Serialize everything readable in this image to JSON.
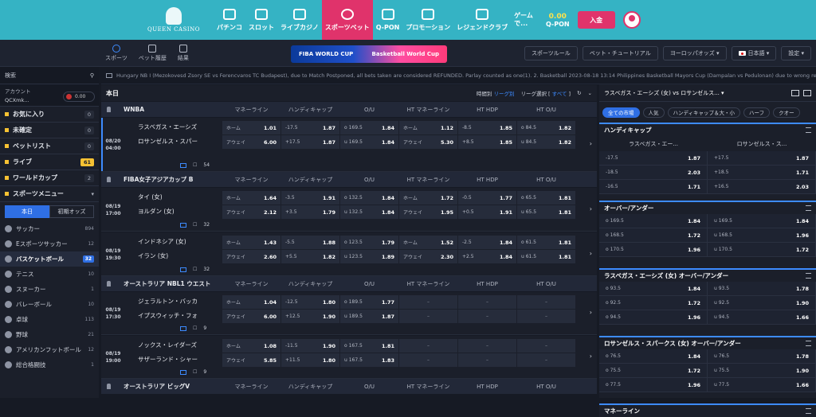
{
  "brand": {
    "logo_text": "QUEEN CASINO"
  },
  "nav": [
    {
      "label": "パチンコ",
      "icon": "pachinko-icon"
    },
    {
      "label": "スロット",
      "icon": "slot-icon"
    },
    {
      "label": "ライブカジノ",
      "icon": "live-casino-icon"
    },
    {
      "label": "スポーツベット",
      "icon": "sports-ball-icon",
      "active": true
    },
    {
      "label": "Q-PON",
      "icon": "qpon-icon"
    },
    {
      "label": "プロモーション",
      "icon": "gift-icon"
    },
    {
      "label": "レジェンドクラブ",
      "icon": "crown-icon"
    },
    {
      "label": "ゲーム\nで...",
      "icon": ""
    }
  ],
  "balance": {
    "amount": "0.00",
    "label": "Q-PON"
  },
  "deposit_label": "入金",
  "subnav": [
    {
      "label": "スポーツ"
    },
    {
      "label": "ベット履歴"
    },
    {
      "label": "結果"
    }
  ],
  "banner": {
    "left": "FIBA WORLD CUP",
    "right": "Basketball World Cup"
  },
  "subbtns": {
    "rules": "スポーツルール",
    "tutorial": "ベット・チュートリアル",
    "odds": "ヨーロッパオッズ ▾",
    "lang": "日本語 ▾",
    "settings": "設定 ▾"
  },
  "ticker": "Hungary NB I (Mezokovesd Zsory SE vs Ferencvaros TC Budapest), due to Match Postponed, all bets taken are considered REFUNDED. Parlay counted as one(1).  2. Basketball 2023-08-18 13:14 Philippines Basketball Mayors Cup (Dampalan vs Pedulonan) due to wrong result received 4th",
  "sidebar": {
    "search": "検索",
    "account_label": "アカウント",
    "account_id": "QCXmk...",
    "account_bal": "0.00",
    "items": [
      {
        "label": "お気に入り",
        "count": "0"
      },
      {
        "label": "未確定",
        "count": "0"
      },
      {
        "label": "ベットリスト",
        "count": "0"
      },
      {
        "label": "ライブ",
        "count": "61",
        "hl": true
      },
      {
        "label": "ワールドカップ",
        "count": "2"
      }
    ],
    "menu_label": "スポーツメニュー",
    "seg": [
      "本日",
      "初期オッズ"
    ],
    "sports": [
      {
        "label": "サッカー",
        "count": "894"
      },
      {
        "label": "Eスポーツサッカー",
        "count": "12"
      },
      {
        "label": "バスケットボール",
        "count": "32",
        "on": true
      },
      {
        "label": "テニス",
        "count": "10"
      },
      {
        "label": "スヌーカー",
        "count": "1"
      },
      {
        "label": "バレーボール",
        "count": "10"
      },
      {
        "label": "卓球",
        "count": "113"
      },
      {
        "label": "野球",
        "count": "21"
      },
      {
        "label": "アメリカンフットボール",
        "count": "12"
      },
      {
        "label": "総合格闘技",
        "count": "1"
      }
    ]
  },
  "main": {
    "title": "本日",
    "sort_label": "時間別",
    "sort_value": "リーグ別",
    "league_sel": "リーグ選択 [",
    "league_sel_val": "すべて",
    "league_sel_end": "]",
    "cols": [
      "マネーライン",
      "ハンディキャップ",
      "O/U",
      "HT マネーライン",
      "HT HDP",
      "HT O/U"
    ],
    "home": "ホーム",
    "away": "アウェイ",
    "leagues": [
      {
        "name": "WNBA"
      },
      {
        "name": "FIBA女子アジアカップ B"
      },
      {
        "name": "オーストラリア NBL1 ウエスト"
      },
      {
        "name": "オーストラリア ビッグV"
      }
    ],
    "matches": [
      {
        "date": "08/20",
        "time": "04:00",
        "t1": "ラスベガス・エーシズ",
        "t2": "ロサンゼルス・スパー",
        "more": "54",
        "o": [
          [
            "1.01",
            "-17.5",
            "1.87",
            "o 169.5",
            "1.84",
            "1.12",
            "-8.5",
            "1.85",
            "o 84.5",
            "1.82"
          ],
          [
            "6.00",
            "+17.5",
            "1.87",
            "u 169.5",
            "1.84",
            "5.30",
            "+8.5",
            "1.85",
            "u 84.5",
            "1.82"
          ]
        ]
      },
      {
        "date": "08/19",
        "time": "17:00",
        "t1": "タイ (女)",
        "t2": "ヨルダン (女)",
        "more": "32",
        "o": [
          [
            "1.64",
            "-3.5",
            "1.91",
            "o 132.5",
            "1.84",
            "1.72",
            "-0.5",
            "1.77",
            "o 65.5",
            "1.81"
          ],
          [
            "2.12",
            "+3.5",
            "1.79",
            "u 132.5",
            "1.84",
            "1.95",
            "+0.5",
            "1.91",
            "u 65.5",
            "1.81"
          ]
        ]
      },
      {
        "date": "08/19",
        "time": "19:30",
        "t1": "インドネシア (女)",
        "t2": "イラン (女)",
        "more": "32",
        "o": [
          [
            "1.43",
            "-5.5",
            "1.88",
            "o 123.5",
            "1.79",
            "1.52",
            "-2.5",
            "1.84",
            "o 61.5",
            "1.81"
          ],
          [
            "2.60",
            "+5.5",
            "1.82",
            "u 123.5",
            "1.89",
            "2.30",
            "+2.5",
            "1.84",
            "u 61.5",
            "1.81"
          ]
        ]
      },
      {
        "date": "08/19",
        "time": "17:30",
        "t1": "ジェラルトン・バッカ",
        "t2": "イプスウィッチ・フォ",
        "more": "9",
        "o": [
          [
            "1.04",
            "-12.5",
            "1.80",
            "o 189.5",
            "1.77",
            "",
            "",
            "",
            "",
            ""
          ],
          [
            "6.00",
            "+12.5",
            "1.90",
            "u 189.5",
            "1.87",
            "",
            "",
            "",
            "",
            ""
          ]
        ]
      },
      {
        "date": "08/19",
        "time": "19:00",
        "t1": "ノックス・レイダーズ",
        "t2": "サザーランド・シャー",
        "more": "9",
        "o": [
          [
            "1.08",
            "-11.5",
            "1.90",
            "o 167.5",
            "1.81",
            "",
            "",
            "",
            "",
            ""
          ],
          [
            "5.85",
            "+11.5",
            "1.80",
            "u 167.5",
            "1.83",
            "",
            "",
            "",
            "",
            ""
          ]
        ]
      }
    ],
    "dash": "–"
  },
  "right": {
    "title": "ラスベガス・エーシズ (女) vs ロサンゼルス... ▾",
    "tabs": [
      "全ての市場",
      "人気",
      "ハンディキャップ＆大・小",
      "ハーフ",
      "クオー"
    ],
    "sections": [
      {
        "title": "ハンディキャップ",
        "cols": [
          "ラスベガス・エー...",
          "ロサンゼルス・ス..."
        ],
        "rows": [
          [
            "-17.5",
            "1.87",
            "+17.5",
            "1.87"
          ],
          [
            "-18.5",
            "2.03",
            "+18.5",
            "1.71"
          ],
          [
            "-16.5",
            "1.71",
            "+16.5",
            "2.03"
          ]
        ]
      },
      {
        "title": "オーバー/アンダー",
        "rows": [
          [
            "o 169.5",
            "1.84",
            "u 169.5",
            "1.84"
          ],
          [
            "o 168.5",
            "1.72",
            "u 168.5",
            "1.96"
          ],
          [
            "o 170.5",
            "1.96",
            "u 170.5",
            "1.72"
          ]
        ]
      },
      {
        "title": "ラスベガス・エーシズ (女) オーバー/アンダー",
        "rows": [
          [
            "o 93.5",
            "1.84",
            "u 93.5",
            "1.78"
          ],
          [
            "o 92.5",
            "1.72",
            "u 92.5",
            "1.90"
          ],
          [
            "o 94.5",
            "1.96",
            "u 94.5",
            "1.66"
          ]
        ]
      },
      {
        "title": "ロサンゼルス・スパークス (女) オーバー/アンダー",
        "rows": [
          [
            "o 76.5",
            "1.84",
            "u 76.5",
            "1.78"
          ],
          [
            "o 75.5",
            "1.72",
            "u 75.5",
            "1.90"
          ],
          [
            "o 77.5",
            "1.96",
            "u 77.5",
            "1.66"
          ]
        ]
      },
      {
        "title": "マネーライン",
        "rows": []
      }
    ]
  }
}
